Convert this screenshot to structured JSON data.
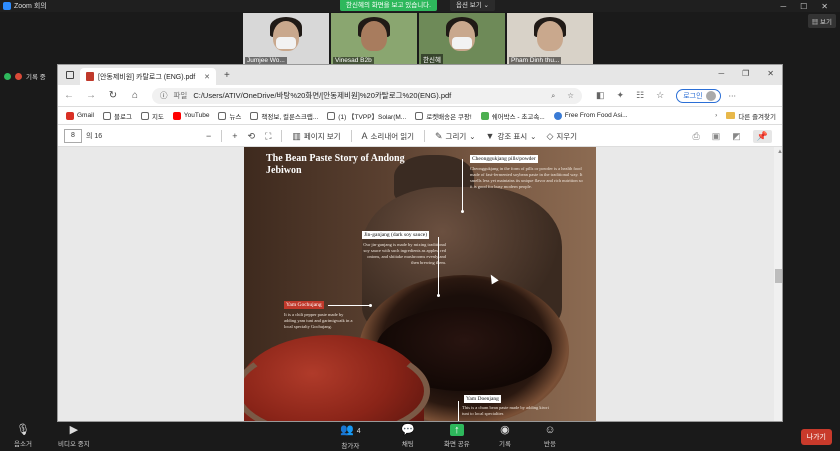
{
  "zoom": {
    "title": "Zoom 회의",
    "share_banner": "한신혜의 화면을 보고 있습니다.",
    "options": "옵션 보기 ⌄",
    "view": "보기",
    "record": "기록 중",
    "participants": [
      {
        "name": "Jumjee Wo..."
      },
      {
        "name": "Vinesad B2b"
      },
      {
        "name": "한신혜"
      },
      {
        "name": "Pham Dinh thu..."
      }
    ],
    "bottom": {
      "audio": "음소거",
      "video": "비디오 중지",
      "participants_label": "참가자",
      "participants_count": "4",
      "chat": "채팅",
      "share": "화면 공유",
      "record": "기록",
      "reactions": "반응",
      "leave": "나가기"
    }
  },
  "browser": {
    "tab_title": "[안동제비원] 카탈로그 (ENG).pdf",
    "address_label": "파일",
    "address_path": "C:/Users/ATIV/OneDrive/바탕%20화면/[안동제비원]%20카탈로그%20(ENG).pdf",
    "login_label": "로그인",
    "bookmarks": [
      {
        "label": "Gmail",
        "color": "#d93025"
      },
      {
        "label": "블로그",
        "color": "#ffffff"
      },
      {
        "label": "지도",
        "color": "#ffffff"
      },
      {
        "label": "YouTube",
        "color": "#ff0000"
      },
      {
        "label": "뉴스",
        "color": "#ffffff"
      },
      {
        "label": "책정보, 컬룬스크랩...",
        "color": "#ffffff"
      },
      {
        "label": "(1) 【TVPP】Solar(M...",
        "color": "#ffffff"
      },
      {
        "label": "로켓배송은 쿠팡!",
        "color": "#ffffff"
      },
      {
        "label": "쉐어박스 - 초고속...",
        "color": "#4caf50"
      },
      {
        "label": "Free From Food Asi...",
        "color": "#3a7bd5"
      }
    ],
    "bookmarks_other": "다른 즐겨찾기"
  },
  "pdf_toolbar": {
    "page": "8",
    "page_of": "의 16",
    "page_view": "페이지 보기",
    "read_aloud": "소리내어 읽기",
    "draw": "그리기",
    "highlight": "강조 표시",
    "erase": "지우기"
  },
  "pdf_page": {
    "title": "The Bean Paste Story of Andong Jebiwon",
    "cheonggukjang_label": "Cheonggukjang pills/powder",
    "cheonggukjang_text": "Cheonggukjang in the form of pills or powder is a health food made of fast-fermented soybean paste in the traditional way. It smells less yet maintains its unique flavor and rich nutrition so it is good for busy modern people.",
    "jin_ganjang_label": "Jin-ganjang (dark soy sauce)",
    "jin_ganjang_text": "Our jin-ganjang is made by mixing traditional soy sauce with such ingredients as apples, red onions, and shiitake mushrooms evenly and then brewing them.",
    "gochujang_label": "Yam Gochujang",
    "gochujang_text": "It is a chili pepper paste made by adding yam tuni and garimigwaik in a local specialty Gochujang.",
    "doenjang_label": "Yam Doenjang",
    "doenjang_text": "This is a chum bean paste made by adding kiwri tuni to local specialties"
  }
}
